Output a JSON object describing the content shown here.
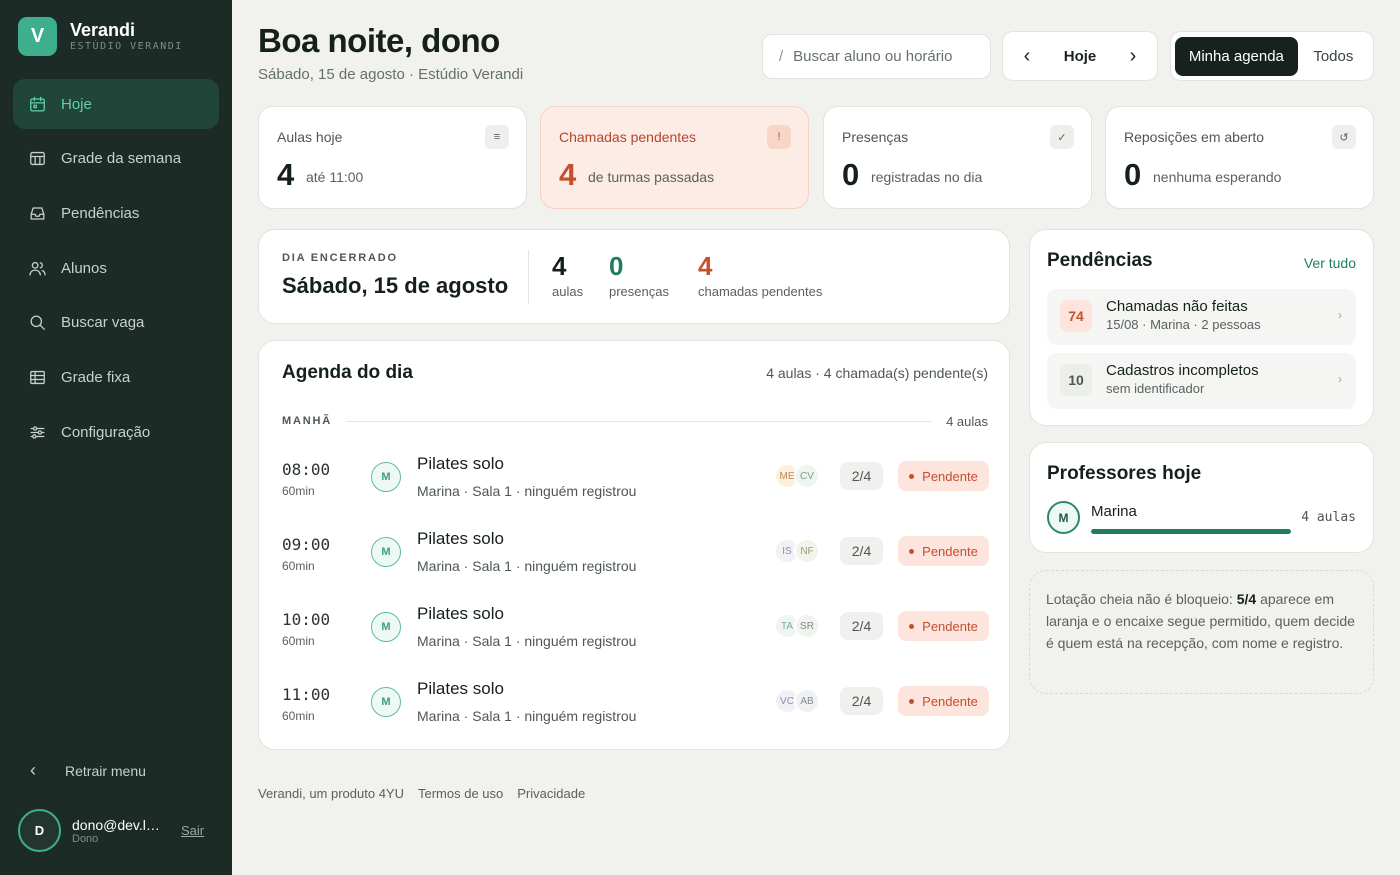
{
  "brand": {
    "initial": "V",
    "name": "Verandi",
    "subtitle": "ESTÚDIO VERANDI"
  },
  "nav": [
    {
      "label": "Hoje",
      "icon": "calendar-icon",
      "active": true
    },
    {
      "label": "Grade da semana",
      "icon": "week-grid-icon"
    },
    {
      "label": "Pendências",
      "icon": "inbox-icon"
    },
    {
      "label": "Alunos",
      "icon": "users-icon"
    },
    {
      "label": "Buscar vaga",
      "icon": "search-icon"
    },
    {
      "label": "Grade fixa",
      "icon": "table-icon"
    },
    {
      "label": "Configuração",
      "icon": "sliders-icon"
    }
  ],
  "sidebar": {
    "collapse_label": "Retrair menu",
    "user": {
      "initial": "D",
      "email": "dono@dev.local",
      "role": "Dono",
      "logout": "Sair"
    }
  },
  "header": {
    "greeting": "Boa noite, dono",
    "subtitle": "Sábado, 15 de agosto · Estúdio Verandi",
    "search_placeholder": "Buscar aluno ou horário",
    "search_prefix": "/",
    "today": "Hoje",
    "scope_mine": "Minha agenda",
    "scope_all": "Todos"
  },
  "stats": [
    {
      "label": "Aulas hoje",
      "badge": "≡",
      "value": "4",
      "note": "até 11:00"
    },
    {
      "label": "Chamadas pendentes",
      "badge": "!",
      "value": "4",
      "note": "de turmas passadas"
    },
    {
      "label": "Presenças",
      "badge": "✓",
      "value": "0",
      "note": "registradas no dia"
    },
    {
      "label": "Reposições em aberto",
      "badge": "↺",
      "value": "0",
      "note": "nenhuma esperando"
    }
  ],
  "day": {
    "eyebrow": "DIA ENCERRADO",
    "title": "Sábado, 15 de agosto",
    "metrics": [
      {
        "value": "4",
        "label": "aulas",
        "color": "#15201b"
      },
      {
        "value": "0",
        "label": "presenças",
        "color": "#1f7d5e"
      },
      {
        "value": "4",
        "label": "chamadas pendentes",
        "color": "#c4502f"
      }
    ]
  },
  "agenda": {
    "title": "Agenda do dia",
    "summary": "4 aulas · 4 chamada(s) pendente(s)",
    "period": {
      "label": "MANHÃ",
      "count": "4 aulas"
    },
    "slots": [
      {
        "time": "08:00",
        "duration": "60min",
        "teacher_initial": "M",
        "name": "Pilates solo",
        "meta": "Marina · Sala 1 · ninguém registrou",
        "students": [
          "ME",
          "CV"
        ],
        "student_colors": [
          "#fbefe0",
          "#edf5ef"
        ],
        "capacity": "2/4",
        "status": "Pendente"
      },
      {
        "time": "09:00",
        "duration": "60min",
        "teacher_initial": "M",
        "name": "Pilates solo",
        "meta": "Marina · Sala 1 · ninguém registrou",
        "students": [
          "IS",
          "NF"
        ],
        "student_colors": [
          "#f1f2f5",
          "#f2f4ea"
        ],
        "capacity": "2/4",
        "status": "Pendente"
      },
      {
        "time": "10:00",
        "duration": "60min",
        "teacher_initial": "M",
        "name": "Pilates solo",
        "meta": "Marina · Sala 1 · ninguém registrou",
        "students": [
          "TA",
          "SR"
        ],
        "student_colors": [
          "#eef5f2",
          "#f1f3ef"
        ],
        "capacity": "2/4",
        "status": "Pendente"
      },
      {
        "time": "11:00",
        "duration": "60min",
        "teacher_initial": "M",
        "name": "Pilates solo",
        "meta": "Marina · Sala 1 · ninguém registrou",
        "students": [
          "VC",
          "AB"
        ],
        "student_colors": [
          "#f0f1f6",
          "#f0f1f2"
        ],
        "capacity": "2/4",
        "status": "Pendente"
      }
    ]
  },
  "pendencias": {
    "title": "Pendências",
    "link": "Ver tudo",
    "items": [
      {
        "count": "74",
        "title": "Chamadas não feitas",
        "sub": "15/08 · Marina · 2 pessoas"
      },
      {
        "count": "10",
        "title": "Cadastros incompletos",
        "sub": "sem identificador"
      }
    ]
  },
  "teachers": {
    "title": "Professores hoje",
    "list": [
      {
        "initial": "M",
        "name": "Marina",
        "count": "4 aulas",
        "load": 1.0
      }
    ]
  },
  "note": {
    "prefix": "Lotação cheia não é bloqueio: ",
    "strong": "5/4",
    "suffix": " aparece em laranja e o encaixe segue permitido, quem decide é quem está na recepção, com nome e registro."
  },
  "footer": {
    "product": "Verandi, um produto 4YU",
    "terms": "Termos de uso",
    "privacy": "Privacidade"
  }
}
